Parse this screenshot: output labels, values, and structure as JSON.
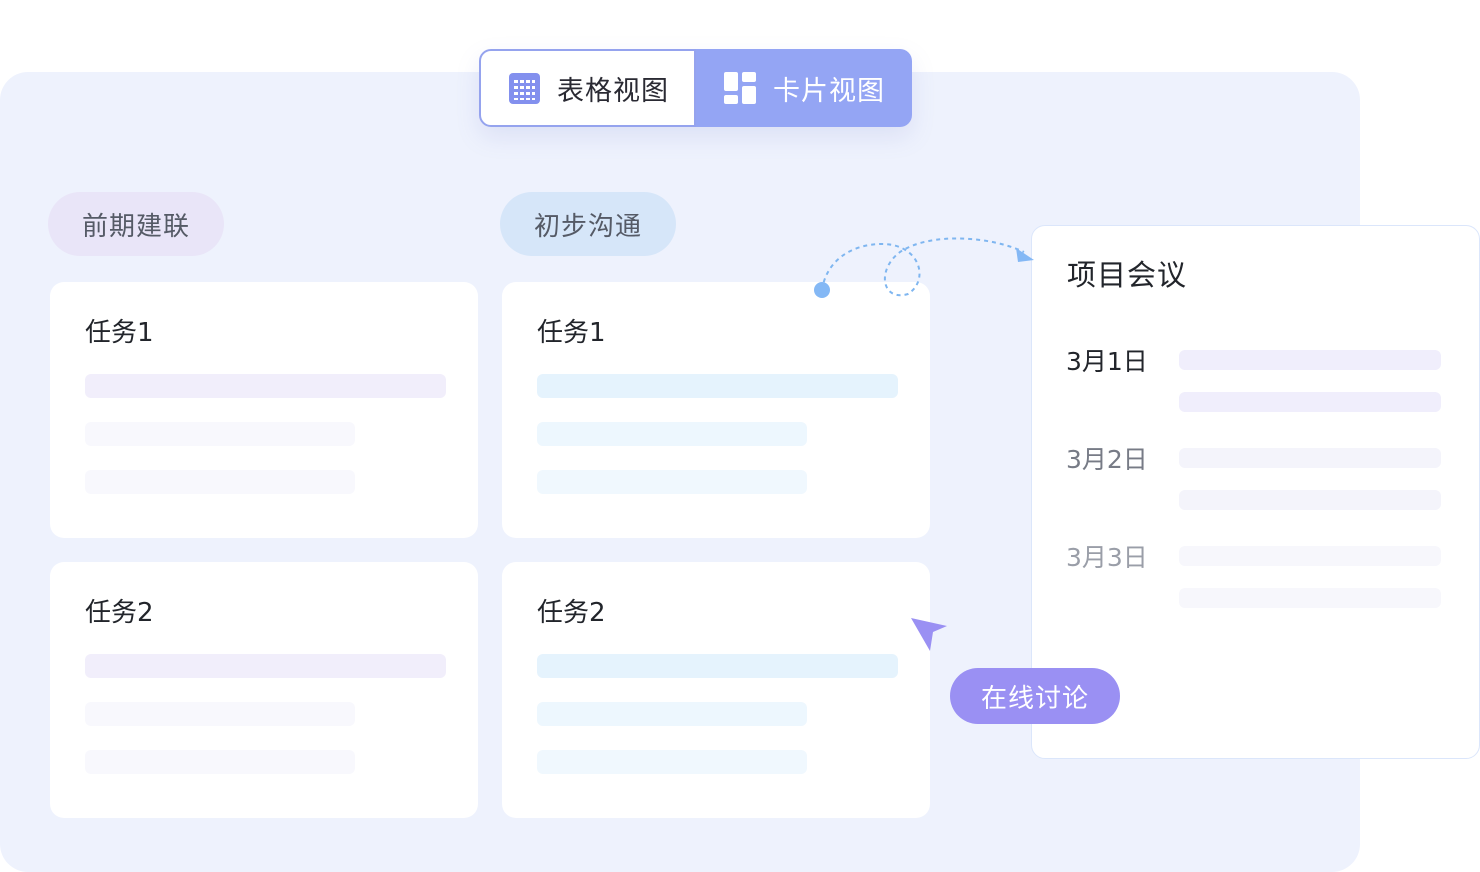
{
  "view_toggle": {
    "table_view_label": "表格视图",
    "card_view_label": "卡片视图",
    "active": "card"
  },
  "columns": [
    {
      "label": "前期建联",
      "accent": "#e9e5f8",
      "tasks": [
        {
          "title": "任务1"
        },
        {
          "title": "任务2"
        }
      ]
    },
    {
      "label": "初步沟通",
      "accent": "#d6e6f9",
      "tasks": [
        {
          "title": "任务1"
        },
        {
          "title": "任务2"
        }
      ]
    }
  ],
  "meeting_card": {
    "title": "项目会议",
    "entries": [
      {
        "date": "3月1日"
      },
      {
        "date": "3月2日"
      },
      {
        "date": "3月3日"
      }
    ]
  },
  "discussion_badge": {
    "label": "在线讨论",
    "color": "#9a90f3"
  },
  "colors": {
    "board_background": "#eef2fd",
    "toggle_active": "#94a5f4",
    "connector": "#7fb6f0",
    "cursor": "#9a90f3"
  },
  "icons": [
    "grid-table-icon",
    "card-layout-icon",
    "cursor-arrow-icon"
  ]
}
